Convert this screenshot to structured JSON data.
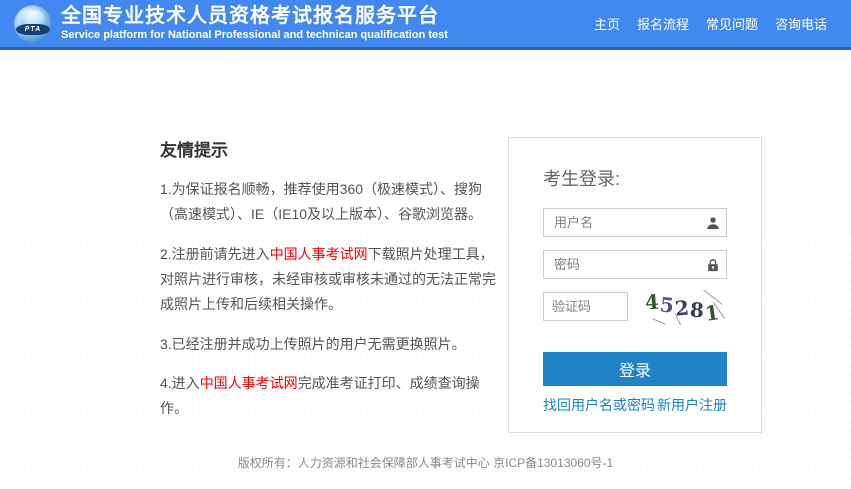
{
  "header": {
    "logo_text": "PTA",
    "title": "全国专业技术人员资格考试报名服务平台",
    "subtitle": "Service platform for National Professional and technican qualification test",
    "nav": [
      {
        "name": "home",
        "label": "主页"
      },
      {
        "name": "registration-process",
        "label": "报名流程"
      },
      {
        "name": "faq",
        "label": "常见问题"
      },
      {
        "name": "contact-phone",
        "label": "咨询电话"
      }
    ]
  },
  "tips": {
    "heading": "友情提示",
    "items": [
      {
        "pre": "1.为保证报名顺畅，推荐使用360（极速模式）、搜狗（高速模式）、IE（IE10及以上版本）、谷歌浏览器。",
        "link": "",
        "post": ""
      },
      {
        "pre": "2.注册前请先进入",
        "link": "中国人事考试网",
        "post": "下载照片处理工具，对照片进行审核，未经审核或审核未通过的无法正常完成照片上传和后续相关操作。"
      },
      {
        "pre": "3.已经注册并成功上传照片的用户无需更换照片。",
        "link": "",
        "post": ""
      },
      {
        "pre": "4.进入",
        "link": "中国人事考试网",
        "post": "完成准考证打印、成绩查询操作。"
      }
    ]
  },
  "login": {
    "heading": "考生登录:",
    "username_placeholder": "用户名",
    "password_placeholder": "密码",
    "captcha_placeholder": "验证码",
    "captcha_digits": [
      "4",
      "5",
      "2",
      "8",
      "1"
    ],
    "login_button": "登录",
    "forgot_link": "找回用户名或密码",
    "register_link": "新用户注册"
  },
  "footer": {
    "copyright": "版权所有：人力资源和社会保障部人事考试中心 京ICP备13013060号-1"
  },
  "colors": {
    "header_blue": "#4189f0",
    "button_blue": "#1f83c6",
    "link_blue": "#1a82c8",
    "alert_red": "#f50000",
    "captcha_digit_colors": [
      "#35582f",
      "#5d4a7e",
      "#3b3b66",
      "#333f52",
      "#2f5437"
    ]
  }
}
